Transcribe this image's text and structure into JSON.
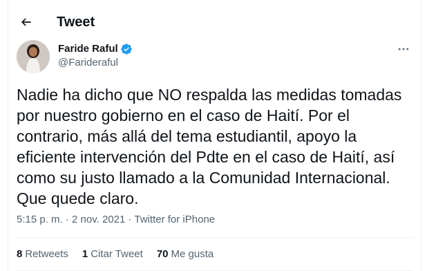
{
  "header": {
    "title": "Tweet"
  },
  "author": {
    "name": "Faride Raful",
    "handle": "@Farideraful",
    "verified_color": "#1d9bf0"
  },
  "tweet": {
    "text": "Nadie ha dicho que NO respalda las medidas tomadas\npor nuestro gobierno en el caso de Haití. Por el\ncontrario, más allá del tema estudiantil, apoyo la\neficiente intervención del Pdte en el caso de Haití, así\ncomo su justo llamado a la Comunidad Internacional.\nQue quede claro.",
    "time": "5:15 p. m.",
    "separator": " · ",
    "date": "2 nov. 2021",
    "source": "Twitter for iPhone"
  },
  "stats": {
    "retweets_count": "8",
    "retweets_label": "Retweets",
    "quotes_count": "1",
    "quotes_label": "Citar Tweet",
    "likes_count": "70",
    "likes_label": "Me gusta"
  },
  "colors": {
    "text": "#0f1419",
    "secondary": "#536471",
    "accent": "#1d9bf0"
  }
}
